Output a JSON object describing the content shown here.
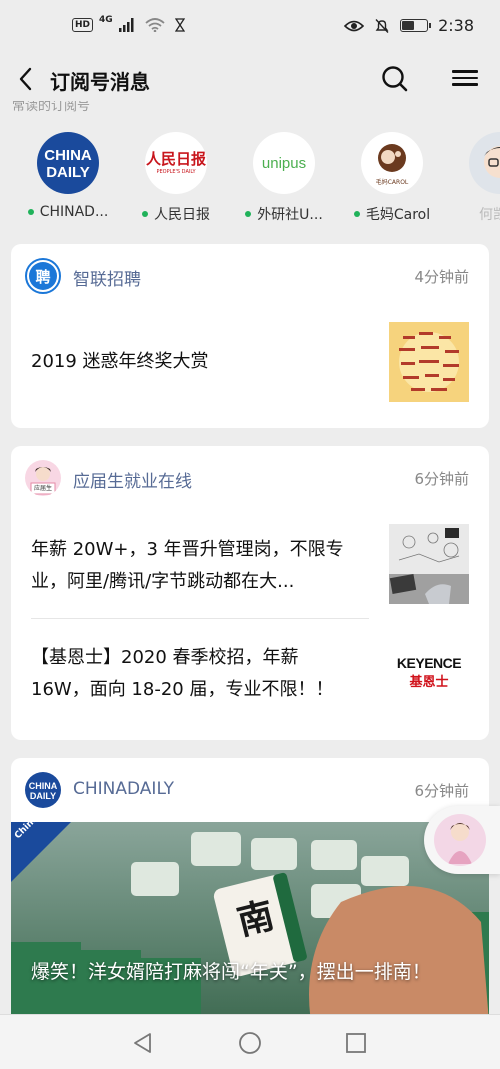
{
  "status_bar": {
    "hd": "HD",
    "net": "4G",
    "time": "2:38",
    "battery_level": 0.55
  },
  "header": {
    "title": "订阅号消息"
  },
  "frequent": {
    "label": "常读的订阅号",
    "accounts": [
      {
        "name": "CHINAD...",
        "logo_text": "CHINA DAILY"
      },
      {
        "name": "人民日报",
        "logo_text": "人民日报",
        "logo_sub": "PEOPLE'S DAILY"
      },
      {
        "name": "外研社U...",
        "logo_text": "unipus"
      },
      {
        "name": "毛妈Carol",
        "logo_text": "毛妈CAROL"
      },
      {
        "name": "何凯文"
      }
    ]
  },
  "cards": [
    {
      "source": "智联招聘",
      "logo_text": "聘",
      "time": "4分钟前",
      "articles": [
        {
          "title": "2019 迷惑年终奖大赏"
        }
      ]
    },
    {
      "source": "应届生就业在线",
      "logo_text": "应届生",
      "time": "6分钟前",
      "articles": [
        {
          "title": "年薪 20W+，3 年晋升管理岗，不限专业，阿里/腾讯/字节跳动都在大..."
        },
        {
          "title": "【基恩士】2020 春季校招，年薪 16W，面向 18-20 届，专业不限！！",
          "thumb_text": "KEYENCE",
          "thumb_sub": "基恩士"
        }
      ]
    },
    {
      "source": "CHINADAILY",
      "logo_text": "CHINA DAILY",
      "time": "6分钟前",
      "cover_badge": "China Daily",
      "cover_tile": "南",
      "articles": [
        {
          "title": "爆笑！洋女婿陪打麻将闯“年关”，摆出一排南！"
        }
      ]
    }
  ],
  "colors": {
    "link_blue": "#576b95",
    "online_green": "#20b25a",
    "chinadaily_blue": "#1a4a9c",
    "people_red": "#c8161d",
    "unipus_green": "#4caf50"
  }
}
